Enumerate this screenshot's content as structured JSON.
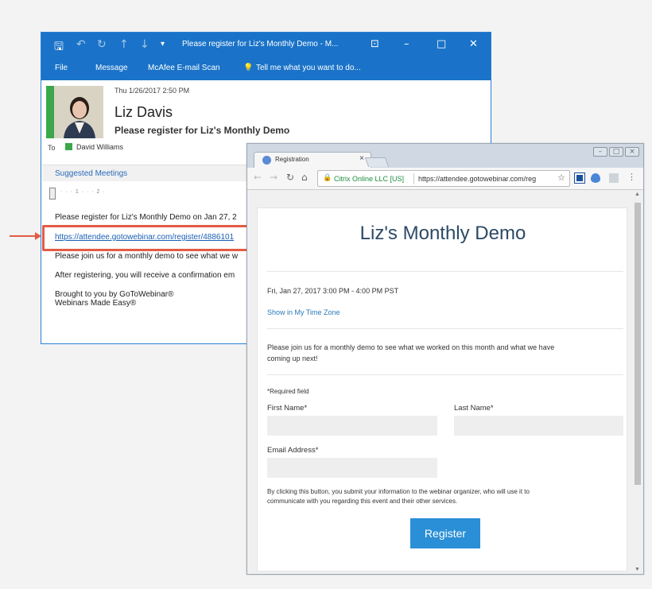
{
  "outlook": {
    "title": "Please register for Liz's Monthly Demo - M...",
    "menu": [
      "File",
      "Message",
      "McAfee E-mail Scan",
      "Tell me what you want to do..."
    ],
    "date": "Thu 1/26/2017 2:50 PM",
    "sender": "Liz Davis",
    "subject": "Please register for Liz's Monthly Demo",
    "to_label": "To",
    "to_name": "David Williams",
    "suggested": "Suggested Meetings",
    "ruler": "· · · 1 · · · 2 ·",
    "body": {
      "line1": "Please register for Liz's Monthly Demo on Jan 27, 2",
      "link": "https://attendee.gotowebinar.com/register/4886101",
      "line3": "Please join us for a monthly demo to see what we w",
      "line4": "After registering, you will receive a confirmation em",
      "line5": "Brought to you by GoToWebinar®",
      "line6": "Webinars Made Easy®"
    }
  },
  "chrome": {
    "tab_title": "Registration",
    "tab_close": "×",
    "secure_org": "Citrix Online LLC [US]",
    "url": "https://attendee.gotowebinar.com/reg",
    "window_buttons": [
      "–",
      "□",
      "×"
    ]
  },
  "page": {
    "title": "Liz's Monthly Demo",
    "datetime": "Fri, Jan 27, 2017 3:00 PM - 4:00 PM PST",
    "timezone_link": "Show in My Time Zone",
    "description1": "Please join us for a monthly demo to see what we worked on this month and what we have",
    "description2": "coming up next!",
    "required": "*Required field",
    "first_name": "First Name*",
    "last_name": "Last Name*",
    "email": "Email Address*",
    "disclaimer1": "By clicking this button, you submit your information to the webinar organizer, who will use it to",
    "disclaimer2": "communicate with you regarding this event and their other services.",
    "register": "Register"
  },
  "colors": {
    "outlook_blue": "#1a73c8",
    "highlight": "#e25c45",
    "register_button": "#2a8fd6"
  }
}
